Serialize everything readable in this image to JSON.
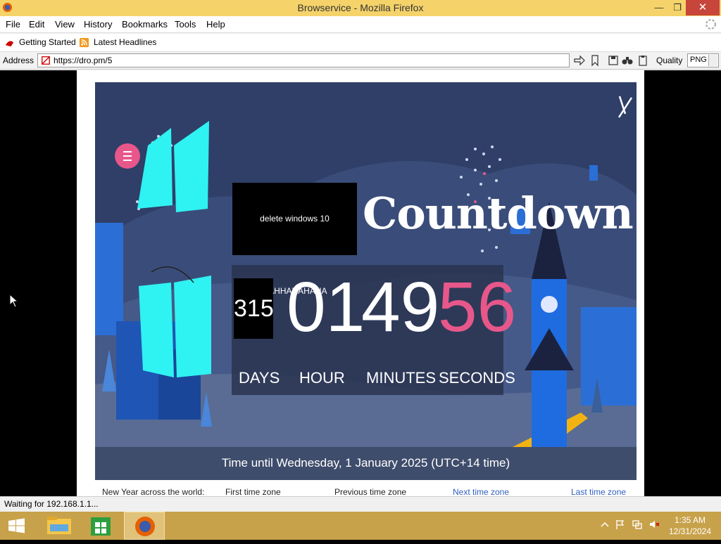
{
  "window": {
    "title": "Browservice - Mozilla Firefox"
  },
  "menu": {
    "items": [
      "File",
      "Edit",
      "View",
      "History",
      "Bookmarks",
      "Tools",
      "Help"
    ]
  },
  "bookmarks": {
    "items": [
      "Getting Started",
      "Latest Headlines"
    ]
  },
  "address": {
    "label": "Address",
    "url": "https://dro.pm/5",
    "quality_label": "Quality",
    "quality_value": "PNG"
  },
  "banner": {
    "overlay_text": "delete windows 10 HAHHAHAHAHA",
    "title": "Countdown",
    "days": "315",
    "hours": "01",
    "minutes": "49",
    "seconds": "56",
    "days_label": "DAYS",
    "hours_label": "HOUR",
    "minutes_label": "MINUTES",
    "seconds_label": "SECONDS",
    "footer": "Time until Wednesday, 1 January 2025 (UTC+14 time)",
    "accent_color": "#e8578a"
  },
  "page_footer": {
    "item1": "New Year across the world:",
    "item2": "First time zone",
    "item3": "Previous time zone",
    "item4": "Next time zone",
    "item5": "Last time zone"
  },
  "status": {
    "text": "Waiting for 192.168.1.1..."
  },
  "taskbar": {
    "time": "1:35 AM",
    "date": "12/31/2024"
  }
}
